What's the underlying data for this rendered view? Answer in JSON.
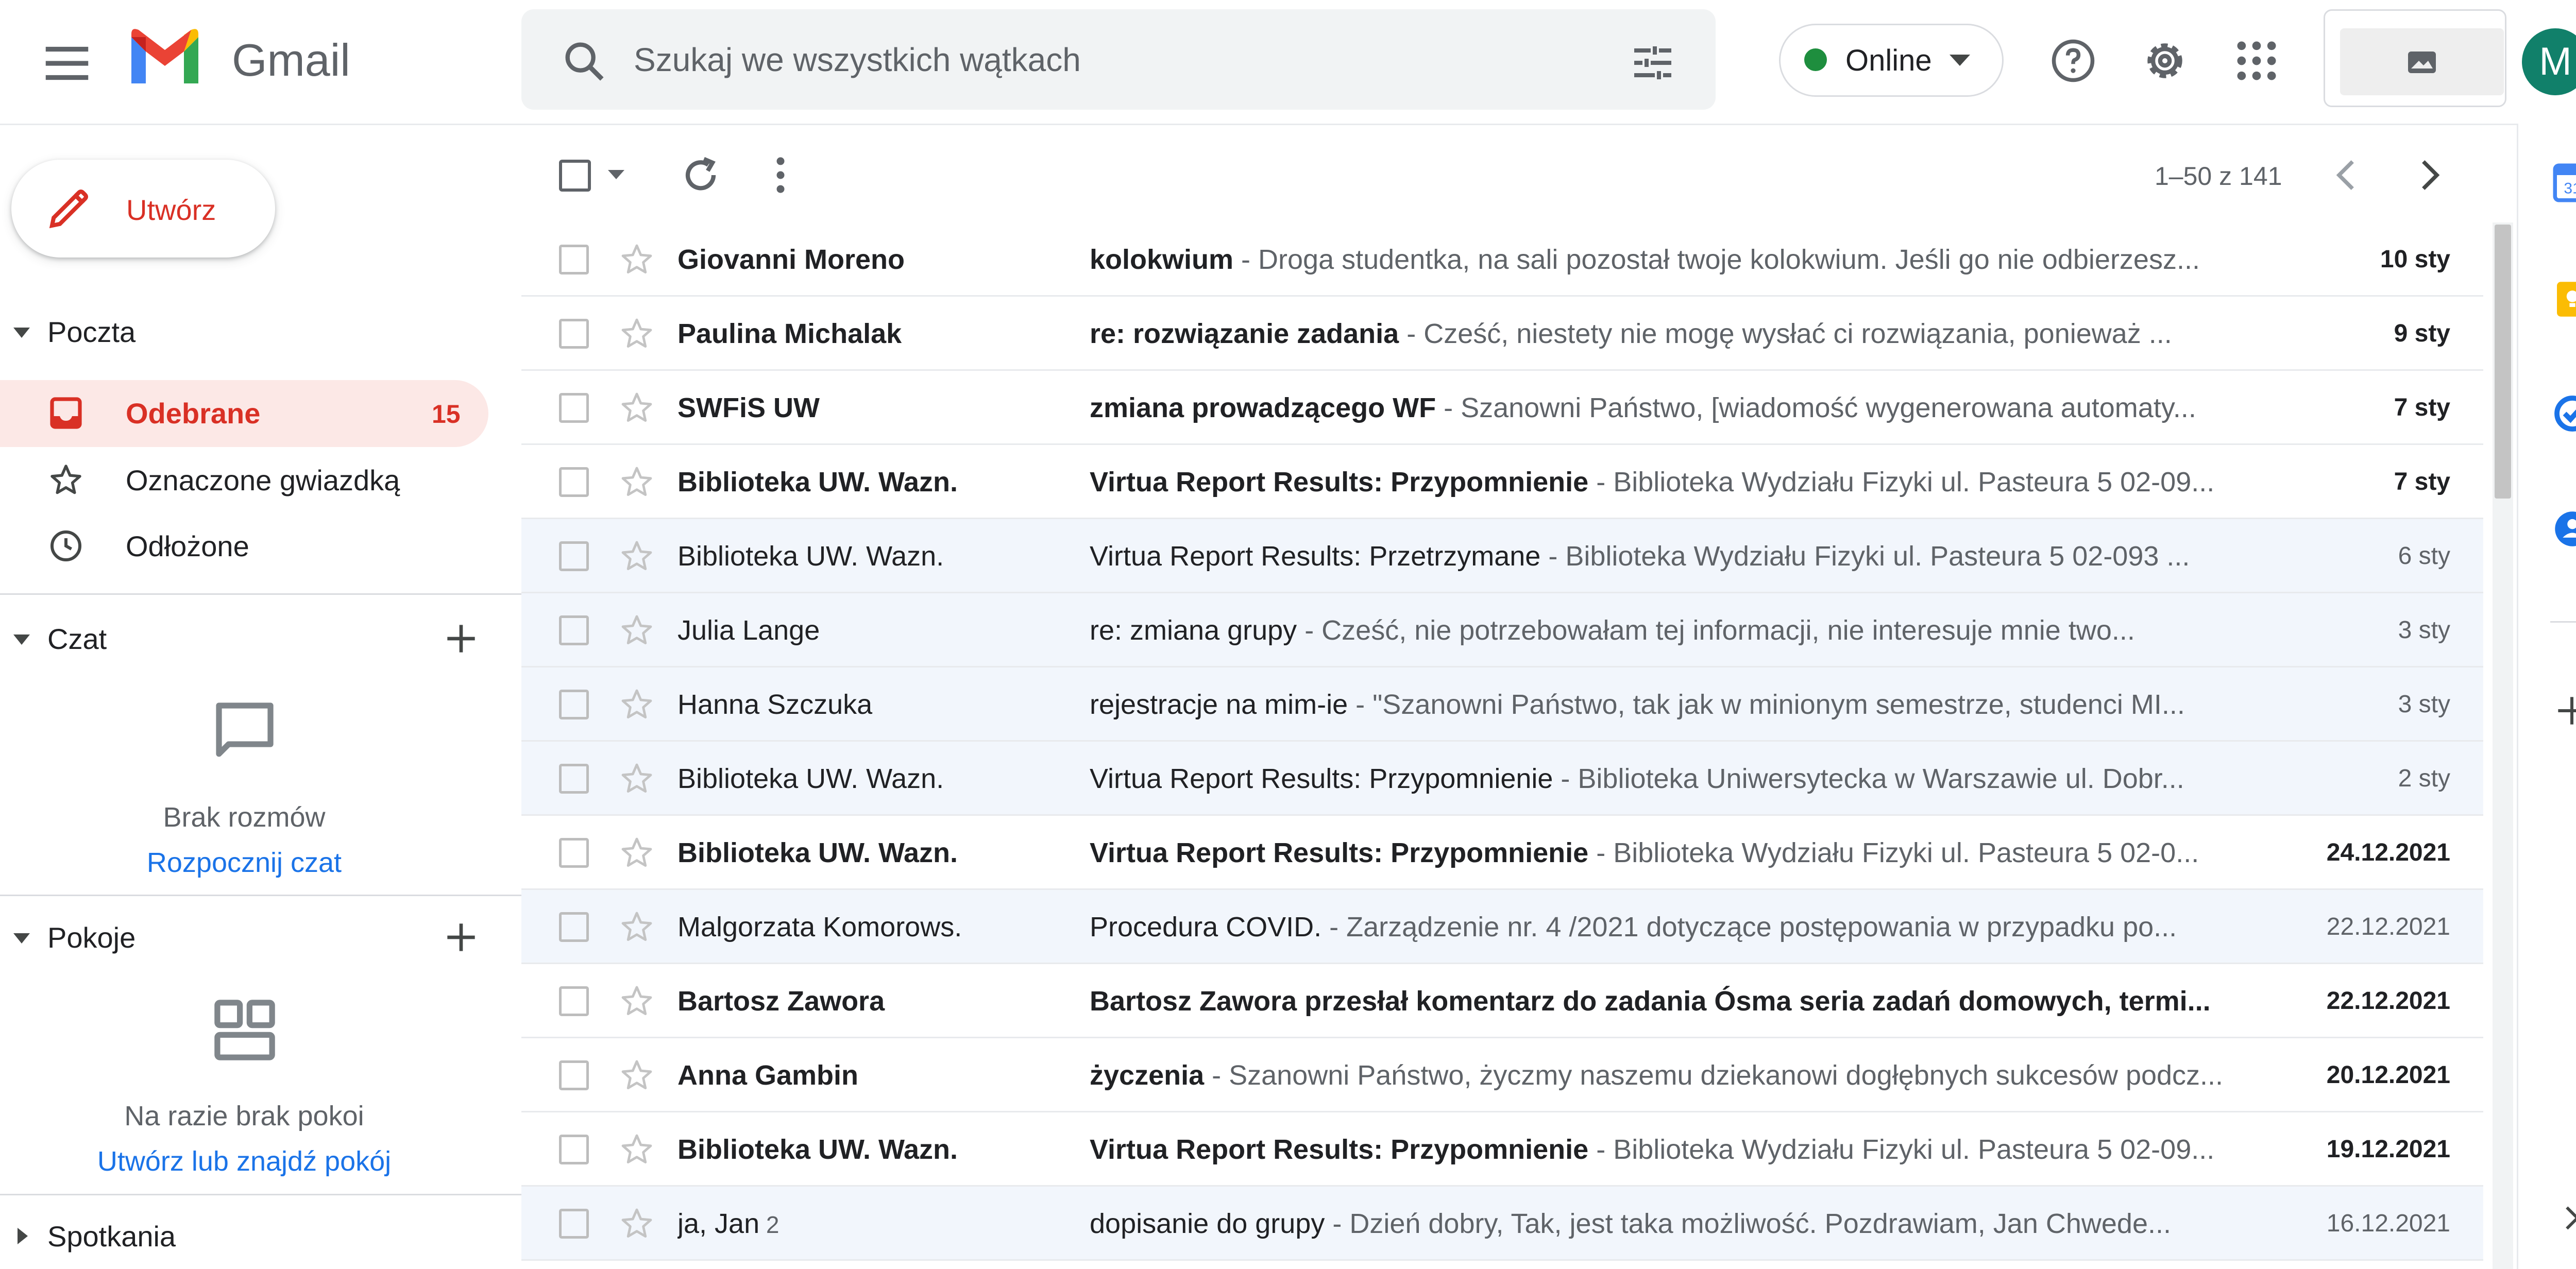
{
  "header": {
    "app_name": "Gmail",
    "search_placeholder": "Szukaj we wszystkich wątkach",
    "status_label": "Online",
    "status_color": "#1e8e3e",
    "avatar_letter": "M",
    "avatar_color": "#11806a",
    "icons": [
      "menu-icon",
      "gmail-logo",
      "search-icon",
      "filter-icon",
      "help-icon",
      "settings-icon",
      "apps-icon",
      "image-icon"
    ]
  },
  "nav": {
    "compose_label": "Utwórz",
    "mail_section": "Poczta",
    "items": [
      {
        "label": "Odebrane",
        "count": "15",
        "icon": "inbox-icon"
      },
      {
        "label": "Oznaczone gwiazdką",
        "icon": "star-icon"
      },
      {
        "label": "Odłożone",
        "icon": "clock-icon"
      }
    ],
    "chat_section": "Czat",
    "chat_empty": "Brak rozmów",
    "chat_link": "Rozpocznij czat",
    "rooms_section": "Pokoje",
    "rooms_empty": "Na razie brak pokoi",
    "rooms_link": "Utwórz lub znajdź pokój",
    "meet_section": "Spotkania"
  },
  "toolbar": {
    "page_count": "1–50 z 141"
  },
  "emails": [
    {
      "sender": "Giovanni Moreno",
      "count": "",
      "subject": "kolokwium",
      "snippet": " - Droga studentka, na sali pozostał twoje kolokwium. Jeśli go nie odbierzesz...",
      "date": "10 sty",
      "unread": true
    },
    {
      "sender": "Paulina Michalak",
      "count": "",
      "subject": "re: rozwiązanie zadania",
      "snippet": " - Cześć, niestety nie mogę wysłać ci rozwiązania, ponieważ ...",
      "date": "9 sty",
      "unread": true
    },
    {
      "sender": "SWFiS UW",
      "count": "",
      "subject": "zmiana prowadzącego WF",
      "snippet": " - Szanowni Państwo, [wiadomość wygenerowana automaty...",
      "date": "7 sty",
      "unread": true
    },
    {
      "sender": "Biblioteka UW. Wazn.",
      "count": "",
      "subject": "Virtua Report Results: Przypomnienie",
      "snippet": " - Biblioteka Wydziału Fizyki ul. Pasteura 5 02-09...",
      "date": "7 sty",
      "unread": true
    },
    {
      "sender": "Biblioteka UW. Wazn.",
      "count": "",
      "subject": "Virtua Report Results: Przetrzymane",
      "snippet": " - Biblioteka Wydziału Fizyki ul. Pasteura 5 02-093 ...",
      "date": "6 sty",
      "unread": false
    },
    {
      "sender": "Julia Lange",
      "count": "",
      "subject": "re: zmiana grupy",
      "snippet": " - Cześć, nie potrzebowałam tej informacji, nie interesuje mnie two...",
      "date": "3 sty",
      "unread": false
    },
    {
      "sender": "Hanna Szczuka",
      "count": "",
      "subject": "rejestracje na mim-ie",
      "snippet": " - \"Szanowni Państwo, tak jak w minionym semestrze, studenci MI...",
      "date": "3 sty",
      "unread": false
    },
    {
      "sender": "Biblioteka UW. Wazn.",
      "count": "",
      "subject": "Virtua Report Results: Przypomnienie",
      "snippet": " - Biblioteka Uniwersytecka w Warszawie ul. Dobr...",
      "date": "2 sty",
      "unread": false
    },
    {
      "sender": "Biblioteka UW. Wazn.",
      "count": "",
      "subject": "Virtua Report Results: Przypomnienie",
      "snippet": " - Biblioteka Wydziału Fizyki ul. Pasteura 5 02-0...",
      "date": "24.12.2021",
      "unread": true
    },
    {
      "sender": "Malgorzata Komorows.",
      "count": "",
      "subject": "Procedura COVID.",
      "snippet": " - Zarządzenie nr. 4 /2021 dotyczące postępowania w przypadku po...",
      "date": "22.12.2021",
      "unread": false
    },
    {
      "sender": "Bartosz Zawora",
      "count": "",
      "subject": "Bartosz Zawora przesłał komentarz do zadania Ósma seria zadań domowych, termi...",
      "snippet": "",
      "date": "22.12.2021",
      "unread": true
    },
    {
      "sender": "Anna Gambin",
      "count": "",
      "subject": "życzenia",
      "snippet": " - Szanowni Państwo, życzmy naszemu dziekanowi dogłębnych sukcesów podcz...",
      "date": "20.12.2021",
      "unread": true
    },
    {
      "sender": "Biblioteka UW. Wazn.",
      "count": "",
      "subject": "Virtua Report Results: Przypomnienie",
      "snippet": " - Biblioteka Wydziału Fizyki ul. Pasteura 5 02-09...",
      "date": "19.12.2021",
      "unread": true
    },
    {
      "sender": "ja, Jan",
      "count": " 2",
      "subject": "dopisanie do grupy",
      "snippet": " - Dzień dobry, Tak, jest taka możliwość. Pozdrawiam, Jan Chwede...",
      "date": "16.12.2021",
      "unread": false
    }
  ],
  "side_panel": {
    "icons": [
      "calendar-icon",
      "keep-icon",
      "tasks-icon",
      "contacts-icon",
      "add-addon-icon",
      "expand-panel-icon"
    ]
  },
  "colors": {
    "accent_red": "#d93025",
    "inbox_highlight": "#fce8e6",
    "link_blue": "#1a73e8"
  }
}
